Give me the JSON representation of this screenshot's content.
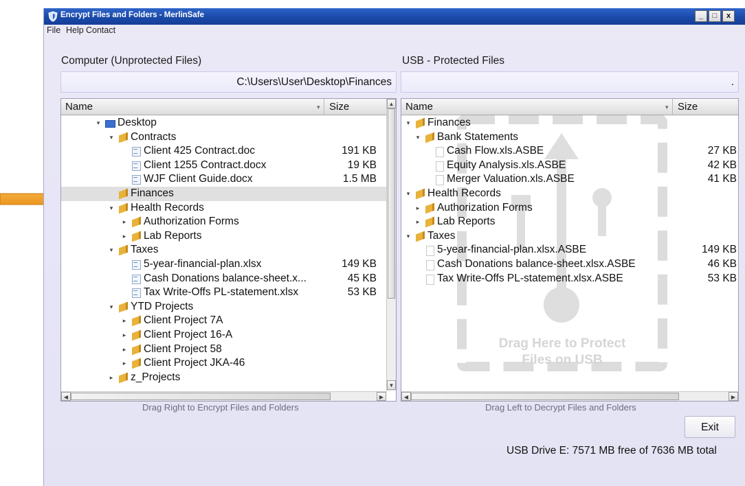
{
  "window": {
    "title": "Encrypt Files and Folders - MerlinSafe",
    "minimize_label": "_",
    "restore_label": "□",
    "close_label": "x"
  },
  "menu": {
    "items": [
      "File",
      "Help",
      "Contact"
    ]
  },
  "left": {
    "title": "Computer (Unprotected Files)",
    "path": "C:\\Users\\User\\Desktop\\Finances",
    "col_name": "Name",
    "col_size": "Size",
    "hint": "Drag Right to Encrypt Files and Folders",
    "rows": [
      {
        "label": "Desktop",
        "size": "",
        "icon": "desktop-icon",
        "level": 0,
        "expander": "▾",
        "selected": false
      },
      {
        "label": "Contracts",
        "size": "",
        "icon": "folder-icon",
        "level": 1,
        "expander": "▾",
        "selected": false
      },
      {
        "label": "Client 425 Contract.doc",
        "size": "191 KB",
        "icon": "document-icon",
        "level": 2,
        "expander": "",
        "selected": false
      },
      {
        "label": "Client 1255 Contract.docx",
        "size": "19 KB",
        "icon": "document-icon",
        "level": 2,
        "expander": "",
        "selected": false
      },
      {
        "label": "WJF Client Guide.docx",
        "size": "1.5 MB",
        "icon": "document-icon",
        "level": 2,
        "expander": "",
        "selected": false
      },
      {
        "label": "Finances",
        "size": "",
        "icon": "folder-icon",
        "level": 1,
        "expander": "",
        "selected": true
      },
      {
        "label": "Health Records",
        "size": "",
        "icon": "folder-icon",
        "level": 1,
        "expander": "▾",
        "selected": false
      },
      {
        "label": "Authorization Forms",
        "size": "",
        "icon": "folder-icon",
        "level": 2,
        "expander": "▸",
        "selected": false
      },
      {
        "label": "Lab Reports",
        "size": "",
        "icon": "folder-icon",
        "level": 2,
        "expander": "▸",
        "selected": false
      },
      {
        "label": "Taxes",
        "size": "",
        "icon": "folder-icon",
        "level": 1,
        "expander": "▾",
        "selected": false
      },
      {
        "label": "5-year-financial-plan.xlsx",
        "size": "149 KB",
        "icon": "document-icon",
        "level": 2,
        "expander": "",
        "selected": false
      },
      {
        "label": "Cash Donations balance-sheet.x...",
        "size": "45 KB",
        "icon": "document-icon",
        "level": 2,
        "expander": "",
        "selected": false
      },
      {
        "label": "Tax Write-Offs PL-statement.xlsx",
        "size": "53 KB",
        "icon": "document-icon",
        "level": 2,
        "expander": "",
        "selected": false
      },
      {
        "label": "YTD Projects",
        "size": "",
        "icon": "folder-icon",
        "level": 1,
        "expander": "▾",
        "selected": false
      },
      {
        "label": "Client Project 7A",
        "size": "",
        "icon": "folder-icon",
        "level": 2,
        "expander": "▸",
        "selected": false
      },
      {
        "label": "Client Project 16-A",
        "size": "",
        "icon": "folder-icon",
        "level": 2,
        "expander": "▸",
        "selected": false
      },
      {
        "label": "Client Project 58",
        "size": "",
        "icon": "folder-icon",
        "level": 2,
        "expander": "▸",
        "selected": false
      },
      {
        "label": "Client Project JKA-46",
        "size": "",
        "icon": "folder-icon",
        "level": 2,
        "expander": "▸",
        "selected": false
      },
      {
        "label": "z_Projects",
        "size": "",
        "icon": "folder-icon",
        "level": 1,
        "expander": "▸",
        "selected": false
      }
    ]
  },
  "right": {
    "title": "USB - Protected Files",
    "path": ".",
    "col_name": "Name",
    "col_size": "Size",
    "hint": "Drag Left to Decrypt Files and Folders",
    "watermark_line1": "Drag Here to Protect",
    "watermark_line2": "Files on USB",
    "rows": [
      {
        "label": "Finances",
        "size": "",
        "icon": "folder-icon",
        "level": 0,
        "expander": "▾"
      },
      {
        "label": "Bank Statements",
        "size": "",
        "icon": "folder-icon",
        "level": 1,
        "expander": "▾"
      },
      {
        "label": "Cash Flow.xls.ASBE",
        "size": "27 KB",
        "icon": "file-icon",
        "level": 2,
        "expander": ""
      },
      {
        "label": "Equity Analysis.xls.ASBE",
        "size": "42 KB",
        "icon": "file-icon",
        "level": 2,
        "expander": ""
      },
      {
        "label": "Merger Valuation.xls.ASBE",
        "size": "41 KB",
        "icon": "file-icon",
        "level": 2,
        "expander": ""
      },
      {
        "label": "Health Records",
        "size": "",
        "icon": "folder-icon",
        "level": 0,
        "expander": "▾"
      },
      {
        "label": "Authorization Forms",
        "size": "",
        "icon": "folder-icon",
        "level": 1,
        "expander": "▸"
      },
      {
        "label": "Lab Reports",
        "size": "",
        "icon": "folder-icon",
        "level": 1,
        "expander": "▸"
      },
      {
        "label": "Taxes",
        "size": "",
        "icon": "folder-icon",
        "level": 0,
        "expander": "▾"
      },
      {
        "label": "5-year-financial-plan.xlsx.ASBE",
        "size": "149 KB",
        "icon": "file-icon",
        "level": 1,
        "expander": ""
      },
      {
        "label": "Cash Donations balance-sheet.xlsx.ASBE",
        "size": "46 KB",
        "icon": "file-icon",
        "level": 1,
        "expander": ""
      },
      {
        "label": "Tax Write-Offs PL-statement.xlsx.ASBE",
        "size": "53 KB",
        "icon": "file-icon",
        "level": 1,
        "expander": ""
      }
    ]
  },
  "exit_label": "Exit",
  "usb_status": "USB Drive E: 7571 MB free of 7636 MB total",
  "colors": {
    "title_bar": "#1a49a8",
    "window_bg": "#e6e5f6",
    "arrow": "#f2a22b",
    "watermark": "#dadada"
  }
}
